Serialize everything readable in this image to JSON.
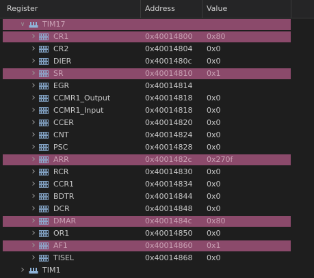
{
  "columns": {
    "register": "Register",
    "address": "Address",
    "value": "Value"
  },
  "tree": [
    {
      "kind": "group",
      "name": "TIM17",
      "expanded": true,
      "highlight": true,
      "address": "",
      "value": ""
    },
    {
      "kind": "reg",
      "name": "CR1",
      "address": "0x40014800",
      "value": "0x80",
      "highlight": true
    },
    {
      "kind": "reg",
      "name": "CR2",
      "address": "0x40014804",
      "value": "0x0",
      "highlight": false
    },
    {
      "kind": "reg",
      "name": "DIER",
      "address": "0x4001480c",
      "value": "0x0",
      "highlight": false
    },
    {
      "kind": "reg",
      "name": "SR",
      "address": "0x40014810",
      "value": "0x1",
      "highlight": true
    },
    {
      "kind": "reg",
      "name": "EGR",
      "address": "0x40014814",
      "value": "",
      "highlight": false
    },
    {
      "kind": "reg",
      "name": "CCMR1_Output",
      "address": "0x40014818",
      "value": "0x0",
      "highlight": false
    },
    {
      "kind": "reg",
      "name": "CCMR1_Input",
      "address": "0x40014818",
      "value": "0x0",
      "highlight": false
    },
    {
      "kind": "reg",
      "name": "CCER",
      "address": "0x40014820",
      "value": "0x0",
      "highlight": false
    },
    {
      "kind": "reg",
      "name": "CNT",
      "address": "0x40014824",
      "value": "0x0",
      "highlight": false
    },
    {
      "kind": "reg",
      "name": "PSC",
      "address": "0x40014828",
      "value": "0x0",
      "highlight": false
    },
    {
      "kind": "reg",
      "name": "ARR",
      "address": "0x4001482c",
      "value": "0x270f",
      "highlight": true
    },
    {
      "kind": "reg",
      "name": "RCR",
      "address": "0x40014830",
      "value": "0x0",
      "highlight": false
    },
    {
      "kind": "reg",
      "name": "CCR1",
      "address": "0x40014834",
      "value": "0x0",
      "highlight": false
    },
    {
      "kind": "reg",
      "name": "BDTR",
      "address": "0x40014844",
      "value": "0x0",
      "highlight": false
    },
    {
      "kind": "reg",
      "name": "DCR",
      "address": "0x40014848",
      "value": "0x0",
      "highlight": false
    },
    {
      "kind": "reg",
      "name": "DMAR",
      "address": "0x4001484c",
      "value": "0x80",
      "highlight": true
    },
    {
      "kind": "reg",
      "name": "OR1",
      "address": "0x40014850",
      "value": "0x0",
      "highlight": false
    },
    {
      "kind": "reg",
      "name": "AF1",
      "address": "0x40014860",
      "value": "0x1",
      "highlight": true
    },
    {
      "kind": "reg",
      "name": "TISEL",
      "address": "0x40014868",
      "value": "0x0",
      "highlight": false
    },
    {
      "kind": "group",
      "name": "TIM1",
      "expanded": false,
      "highlight": false,
      "address": "",
      "value": ""
    }
  ],
  "colors": {
    "highlight": "#8b4a6b",
    "background": "#1e1e1e",
    "header": "#252526",
    "icon": "#8fb3d9"
  }
}
